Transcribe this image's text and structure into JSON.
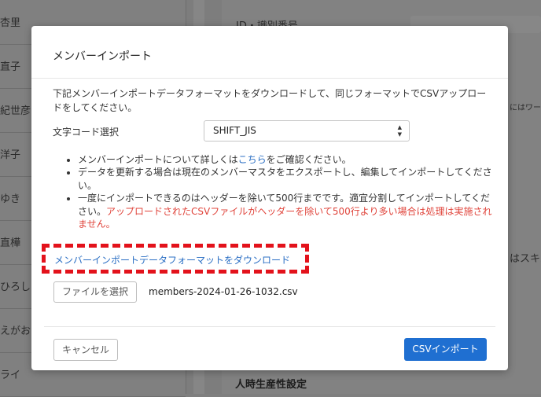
{
  "background": {
    "left_names": [
      "杏里",
      "直子",
      "紀世彦",
      "洋子",
      "ゆき",
      "直樺",
      "ひろし",
      "えがお",
      "ライ"
    ],
    "right_top_label": "ID・識別番号",
    "right_hint": "にはワーク",
    "right_skill": "はスキル",
    "right_heading": "人時生産性設定"
  },
  "modal": {
    "title": "メンバーインポート",
    "description": "下記メンバーインポートデータフォーマットをダウンロードして、同じフォーマットでCSVアップロードをしてください。",
    "encoding": {
      "label": "文字コード選択",
      "selected": "SHIFT_JIS"
    },
    "notes": {
      "note1_pre": "メンバーインポートについて詳しくは",
      "note1_link": "こちら",
      "note1_post": "をご確認ください。",
      "note2": "データを更新する場合は現在のメンバーマスタをエクスポートし、編集してインポートしてください。",
      "note3": "一度にインポートできるのはヘッダーを除いて500行までです。適宜分割してインポートしてください。",
      "note3_warning": "アップロードされたCSVファイルがヘッダーを除いて500行より多い場合は処理は実施されません。"
    },
    "download_link": "メンバーインポートデータフォーマットをダウンロード",
    "file": {
      "button_label": "ファイルを選択",
      "file_name": "members-2024-01-26-1032.csv"
    },
    "cancel_label": "キャンセル",
    "import_label": "CSVインポート"
  },
  "colors": {
    "accent": "#1f6fd1",
    "link": "#2b6fc4",
    "warning": "#e0443b",
    "highlight": "#e3121b"
  }
}
